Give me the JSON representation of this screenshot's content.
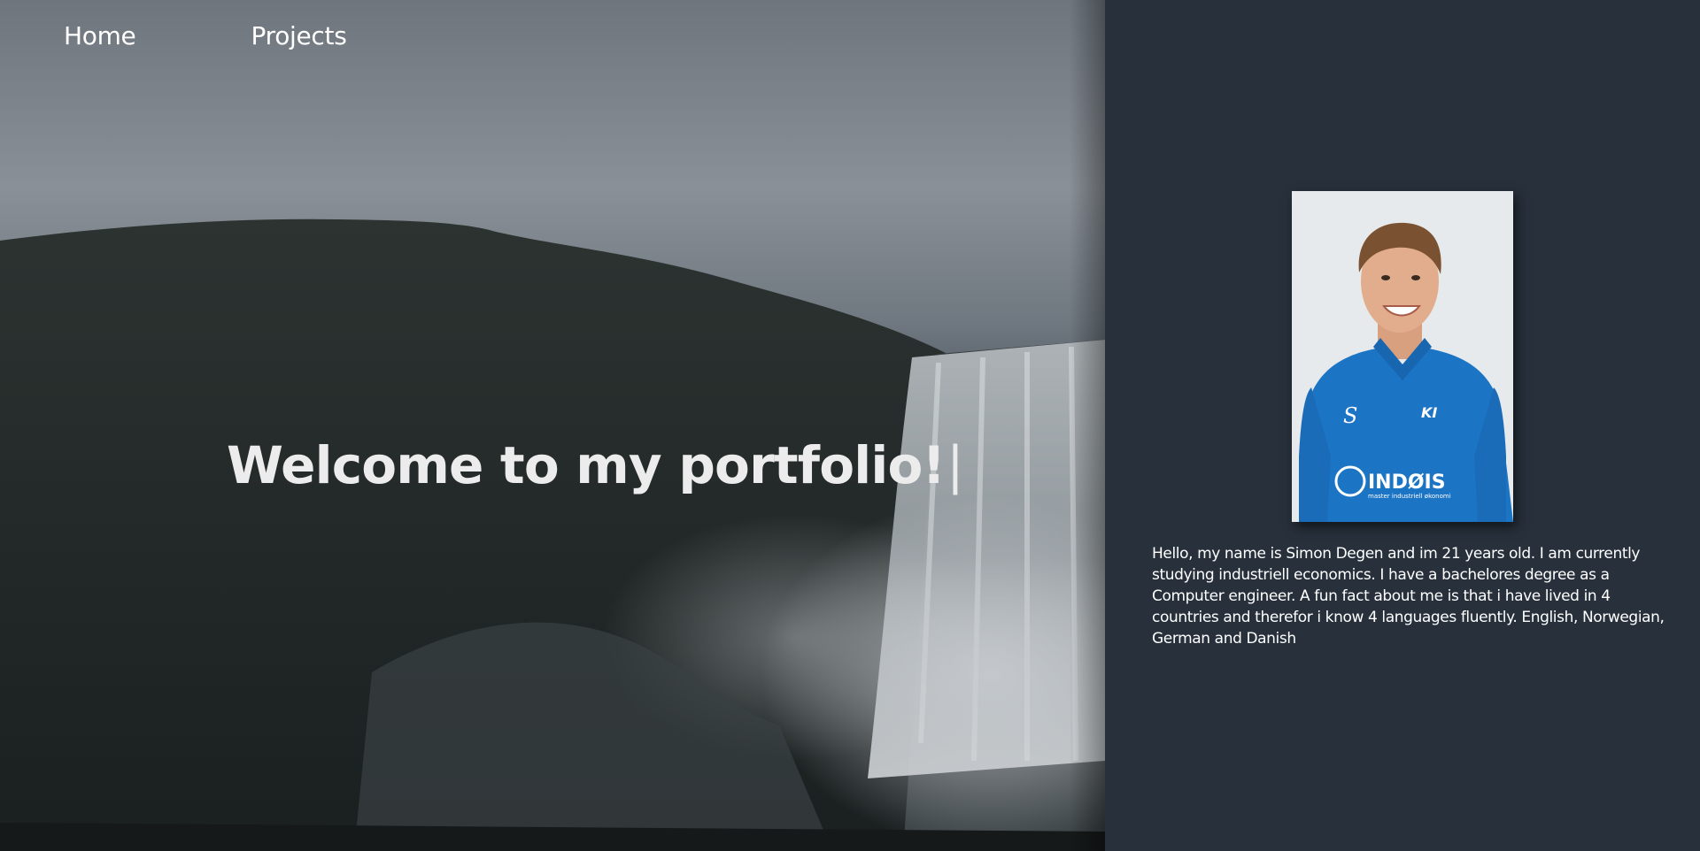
{
  "nav": {
    "home_label": "Home",
    "projects_label": "Projects"
  },
  "hero": {
    "headline": "Welcome to my portfolio!",
    "cursor": "|",
    "background": "waterfall-landscape-image"
  },
  "about": {
    "photo": "profile-photo",
    "shirt_logo_text": "INDØIS",
    "shirt_sub_text": "master industriell økonomi",
    "bio": "Hello, my name is Simon Degen and im 21 years old. I am currently studying industriell economics. I have a bachelores degree as a Computer engineer. A fun fact about me is that i have lived in 4 countries and therefor i know 4 languages fluently. English, Norwegian, German and Danish"
  },
  "colors": {
    "panel_bg": "#27303b",
    "text": "#ffffff",
    "headline": "#ececec",
    "shirt": "#1c74c4"
  }
}
